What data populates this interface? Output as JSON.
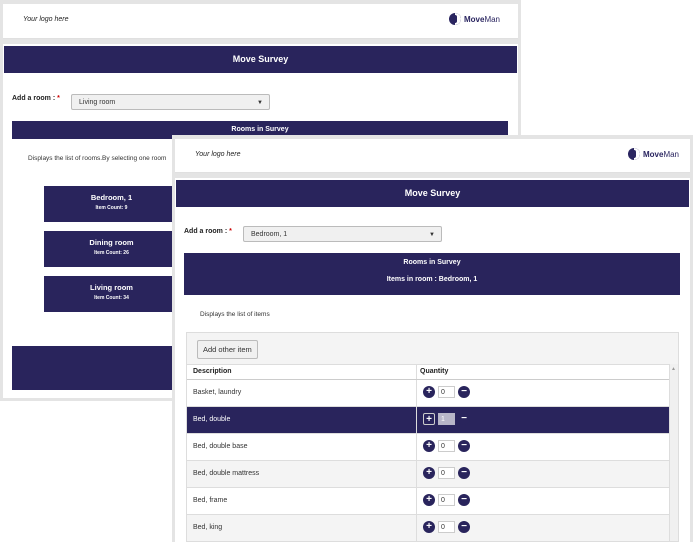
{
  "back": {
    "logo_text": "Your logo here",
    "brand_a": "Move",
    "brand_b": "Man",
    "title": "Move Survey",
    "add_room_label": "Add a room :",
    "required_mark": "*",
    "selected_room": "Living room",
    "rooms_band": "Rooms in Survey",
    "description": "Displays the list of rooms.By selecting one room",
    "rooms": [
      {
        "name": "Bedroom, 1",
        "count": "Item Count: 9"
      },
      {
        "name": "Dining room",
        "count": "Item Count: 26"
      },
      {
        "name": "Living room",
        "count": "Item Count: 34"
      }
    ]
  },
  "front": {
    "logo_text": "Your logo here",
    "brand_a": "Move",
    "brand_b": "Man",
    "title": "Move Survey",
    "add_room_label": "Add a room :",
    "required_mark": "*",
    "selected_room": "Bedroom, 1",
    "rooms_band": "Rooms in Survey",
    "items_band": "Items in room : Bedroom, 1",
    "description": "Displays the list of items",
    "add_other_label": "Add other item",
    "col_description": "Description",
    "col_quantity": "Quantity",
    "items": [
      {
        "name": "Basket, laundry",
        "qty": "0"
      },
      {
        "name": "Bed, double",
        "qty": "1"
      },
      {
        "name": "Bed, double base",
        "qty": "0"
      },
      {
        "name": "Bed, double mattress",
        "qty": "0"
      },
      {
        "name": "Bed, frame",
        "qty": "0"
      },
      {
        "name": "Bed, king",
        "qty": "0"
      }
    ],
    "selected_index": 1
  },
  "colors": {
    "brand": "#29245c"
  }
}
